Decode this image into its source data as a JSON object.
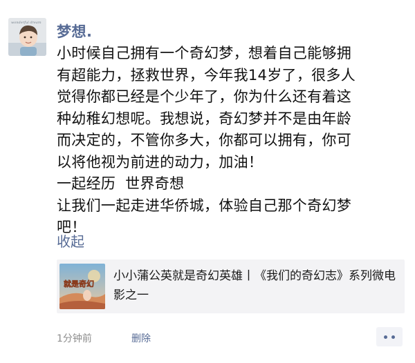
{
  "post": {
    "author": "梦想.",
    "content_lines": [
      "小时候自己拥有一个奇幻梦，想着自己能够拥",
      "有超能力，拯救世界，今年我14岁了，很多人",
      "觉得你都已经是个少年了，你为什么还有着这",
      "种幼稚幻想呢。我想说，奇幻梦并不是由年龄",
      "而决定的，不管你多大，你都可以拥有，你可",
      "以将他视为前进的动力，加油！",
      "一起经历  世界奇想",
      "让我们一起走进华侨城，体验自己那个奇幻梦",
      "吧！"
    ],
    "collapse_label": "收起",
    "avatar_caption": "wonderful dream",
    "share": {
      "title": "小小蒲公英就是奇幻英雄丨《我们的奇幻志》系列微电影之一",
      "thumb_caption": "就是奇幻"
    },
    "time": "1分钟前",
    "delete_label": "删除"
  },
  "colors": {
    "link": "#576b95",
    "text": "#111111",
    "meta": "#8c8c8c",
    "card_bg": "#f3f3f5"
  },
  "icons": {
    "more": "more-dots-icon"
  }
}
